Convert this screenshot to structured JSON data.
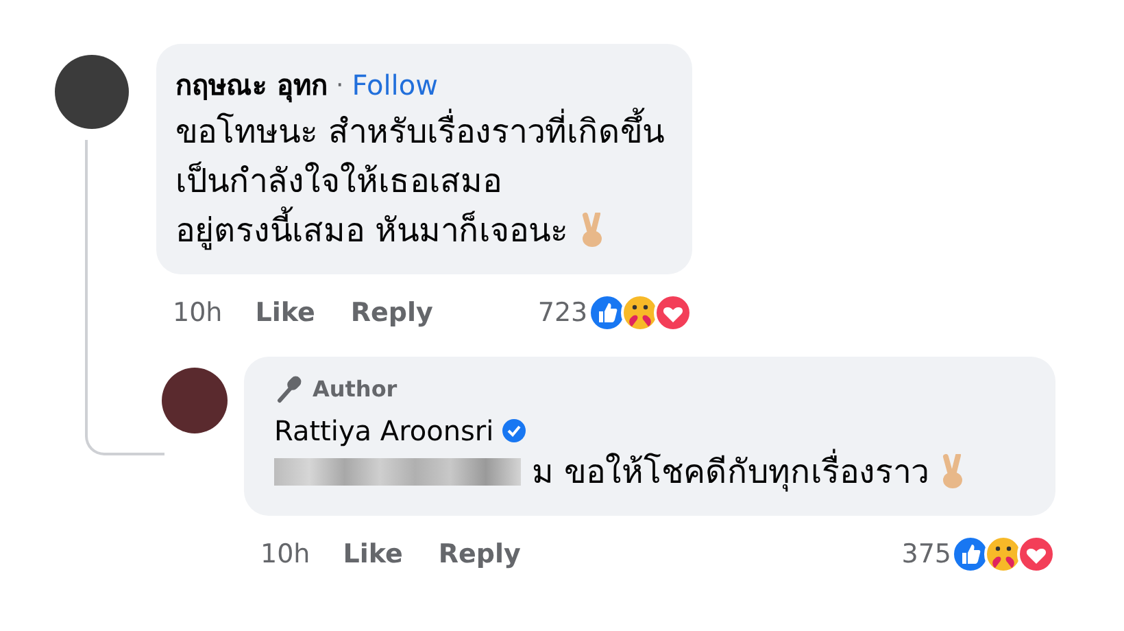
{
  "comments": [
    {
      "author": "กฤษณะ อุทก",
      "separator": "·",
      "follow": "Follow",
      "verified": false,
      "lines": [
        "ขอโทษนะ สำหรับเรื่องราวที่เกิดขึ้น",
        "เป็นกำลังใจให้เธอเสมอ",
        "อยู่ตรงนี้เสมอ หันมาก็เจอนะ"
      ],
      "redacted": false,
      "time": "10h",
      "like": "Like",
      "reply": "Reply",
      "reaction_count": "723",
      "is_reply": false
    },
    {
      "author": "Rattiya Aroonsri",
      "verified": true,
      "badge": "Author",
      "lines": [
        "ม ขอให้โชคดีกับทุกเรื่องราว"
      ],
      "redacted": true,
      "time": "10h",
      "like": "Like",
      "reply": "Reply",
      "reaction_count": "375",
      "is_reply": true
    }
  ]
}
